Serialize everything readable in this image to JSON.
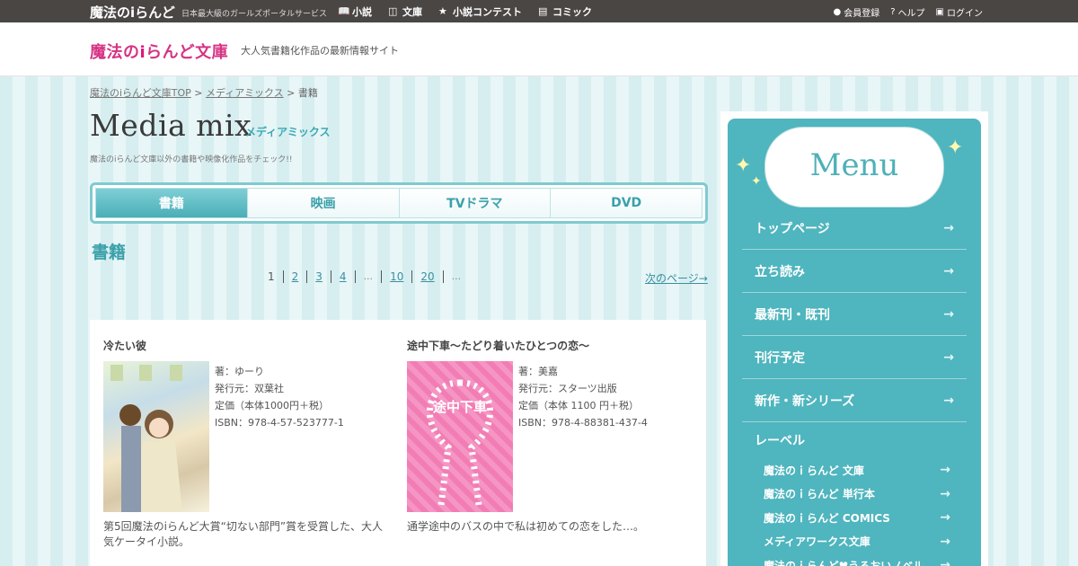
{
  "topbar": {
    "brand_pre": "魔法の",
    "brand_i": "i",
    "brand_post": "らんど",
    "tagline": "日本最大級のガールズポータルサービス",
    "nav": [
      {
        "label": "小説",
        "icon": "book-open-icon"
      },
      {
        "label": "文庫",
        "icon": "books-icon"
      },
      {
        "label": "小説コンテスト",
        "icon": "trophy-icon"
      },
      {
        "label": "コミック",
        "icon": "comic-icon"
      }
    ],
    "account": [
      {
        "label": "会員登録",
        "icon": "user-icon"
      },
      {
        "label": "ヘルプ",
        "icon": "help-icon"
      },
      {
        "label": "ログイン",
        "icon": "lock-icon"
      }
    ]
  },
  "header": {
    "logo_pre": "魔法の",
    "logo_i": "i",
    "logo_post": "らんど文庫",
    "subtitle": "大人気書籍化作品の最新情報サイト"
  },
  "breadcrumb": {
    "items": [
      "魔法のiらんど文庫TOP",
      "メディアミックス"
    ],
    "current": "書籍",
    "sep": ">"
  },
  "page": {
    "title": "Media mix",
    "title_ja": "メディアミックス",
    "description": "魔法のiらんど文庫以外の書籍や映像化作品をチェック!!"
  },
  "tabs": [
    {
      "label": "書籍",
      "active": true
    },
    {
      "label": "映画",
      "active": false
    },
    {
      "label": "TVドラマ",
      "active": false
    },
    {
      "label": "DVD",
      "active": false
    }
  ],
  "section_title": "書籍",
  "pager": {
    "pages": [
      "1",
      "2",
      "3",
      "4",
      "...",
      "10",
      "20",
      "..."
    ],
    "next": "次のページ→"
  },
  "books": [
    {
      "title": "冷たい彼",
      "author": "著：ゆーり",
      "publisher": "発行元：双葉社",
      "price": "定価（本体1000円＋税）",
      "isbn": "ISBN：978-4-57-523777-1",
      "description": "第5回魔法のiらんど大賞“切ない部門”賞を受賞した、大人気ケータイ小説。"
    },
    {
      "title": "途中下車～たどり着いたひとつの恋～",
      "author": "著：美嘉",
      "publisher": "発行元：スターツ出版",
      "price": "定価（本体 1100 円＋税）",
      "isbn": "ISBN：978-4-88381-437-4",
      "description": "通学途中のバスの中で私は初めての恋をした…。",
      "cover_text": "途中下車"
    }
  ],
  "sidebar": {
    "menu_title": "Menu",
    "items": [
      "トップページ",
      "立ち読み",
      "最新刊・既刊",
      "刊行予定",
      "新作・新シリーズ"
    ],
    "label_heading": "レーベル",
    "labels": [
      "魔法のｉらんど 文庫",
      "魔法のｉらんど 単行本",
      "魔法のｉらんど COMICS",
      "メディアワークス文庫",
      "魔法のｉらんど♥うるおいノベル"
    ],
    "arrow": "→"
  }
}
